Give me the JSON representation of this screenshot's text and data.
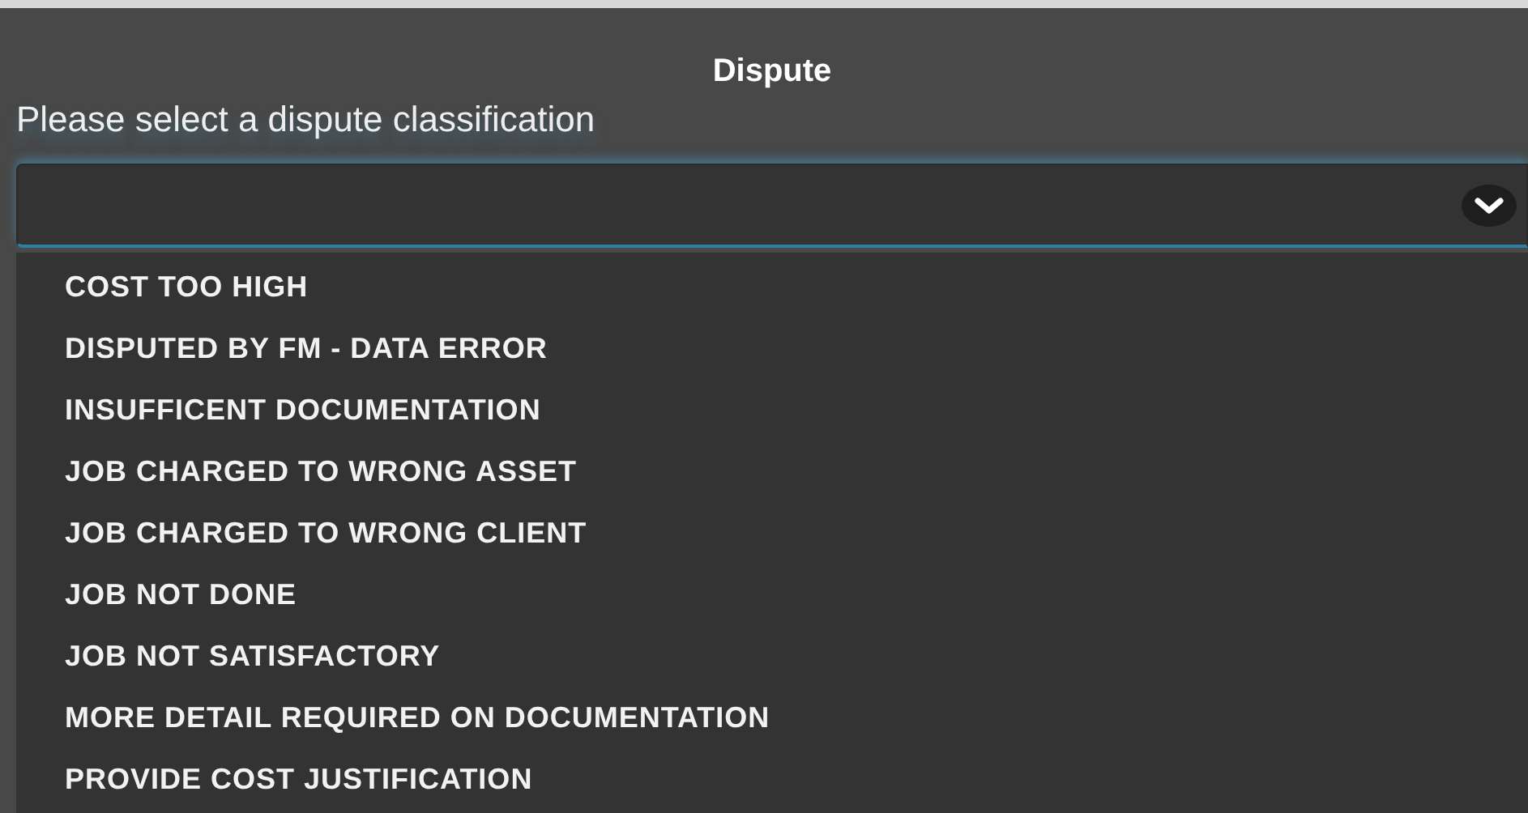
{
  "dialog": {
    "title": "Dispute",
    "prompt": "Please select a dispute classification"
  },
  "select": {
    "expanded": true
  },
  "options": [
    {
      "label": "COST TOO HIGH"
    },
    {
      "label": "DISPUTED BY FM - DATA ERROR"
    },
    {
      "label": "INSUFFICENT DOCUMENTATION"
    },
    {
      "label": "JOB CHARGED TO WRONG ASSET"
    },
    {
      "label": "JOB CHARGED TO WRONG CLIENT"
    },
    {
      "label": "JOB NOT DONE"
    },
    {
      "label": "JOB NOT SATISFACTORY"
    },
    {
      "label": "MORE DETAIL REQUIRED ON DOCUMENTATION"
    },
    {
      "label": "PROVIDE COST JUSTIFICATION"
    }
  ]
}
